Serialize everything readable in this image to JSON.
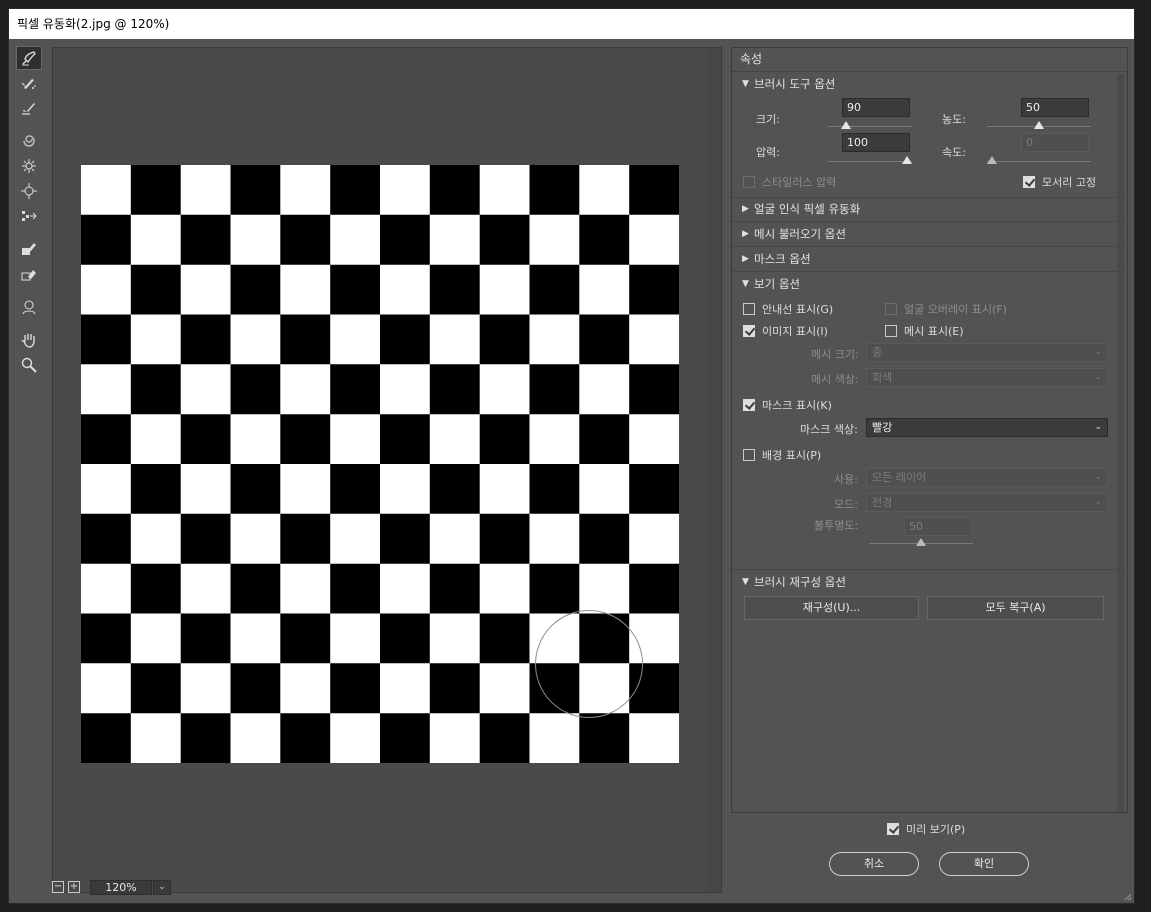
{
  "window": {
    "title": "픽셀 유동화(2.jpg @ 120%)"
  },
  "tools": [
    {
      "name": "forward-warp-tool-icon",
      "active": true
    },
    {
      "name": "reconstruct-tool-icon"
    },
    {
      "name": "smooth-tool-icon"
    },
    {
      "name": "twirl-clockwise-tool-icon"
    },
    {
      "name": "pucker-tool-icon"
    },
    {
      "name": "bloat-tool-icon"
    },
    {
      "name": "push-left-tool-icon"
    },
    {
      "name": "freeze-mask-tool-icon"
    },
    {
      "name": "thaw-mask-tool-icon"
    },
    {
      "name": "face-tool-icon"
    },
    {
      "name": "hand-tool-icon"
    },
    {
      "name": "zoom-tool-icon"
    }
  ],
  "status": {
    "zoom_out": "−",
    "zoom_in": "+",
    "zoom_value": "120%",
    "zoom_dropdown": "⌄"
  },
  "panel": {
    "title": "속성",
    "brush_tool": {
      "header": "브러시 도구 옵션",
      "size_label": "크기:",
      "size_value": "90",
      "size_pos": 0.18,
      "density_label": "농도:",
      "density_value": "50",
      "density_pos": 0.5,
      "pressure_label": "압력:",
      "pressure_value": "100",
      "pressure_pos": 1.0,
      "rate_label": "속도:",
      "rate_value": "0",
      "rate_pos": 0.0,
      "stylus_label": "스타일러스 압력",
      "pin_edges_label": "모서리 고정"
    },
    "face_aware": "얼굴 인식 픽셀 유동화",
    "load_mesh": "메시 불러오기 옵션",
    "mask_options": "마스크 옵션",
    "view": {
      "header": "보기 옵션",
      "show_guides": "안내선 표시(G)",
      "show_face_overlay": "얼굴 오버레이 표시(F)",
      "show_image": "이미지 표시(I)",
      "show_mesh": "메시 표시(E)",
      "mesh_size_label": "메시 크기:",
      "mesh_size_value": "중",
      "mesh_color_label": "메시 색상:",
      "mesh_color_value": "회색",
      "show_mask": "마스크 표시(K)",
      "mask_color_label": "마스크 색상:",
      "mask_color_value": "빨강",
      "show_backdrop": "배경 표시(P)",
      "use_label": "사용:",
      "use_value": "모든 레이어",
      "mode_label": "모드:",
      "mode_value": "전경",
      "opacity_label": "불투명도:",
      "opacity_value": "50",
      "opacity_pos": 0.5
    },
    "reconstruct": {
      "header": "브러시 재구성 옵션",
      "reconstruct_btn": "재구성(U)...",
      "restore_all_btn": "모두 복구(A)"
    }
  },
  "footer": {
    "preview_label": "미리 보기(P)",
    "cancel": "취소",
    "ok": "확인"
  },
  "colors": {
    "window_bg": "#535353",
    "canvas_bg": "#4a4a4a",
    "title_bg": "#ffffff"
  }
}
